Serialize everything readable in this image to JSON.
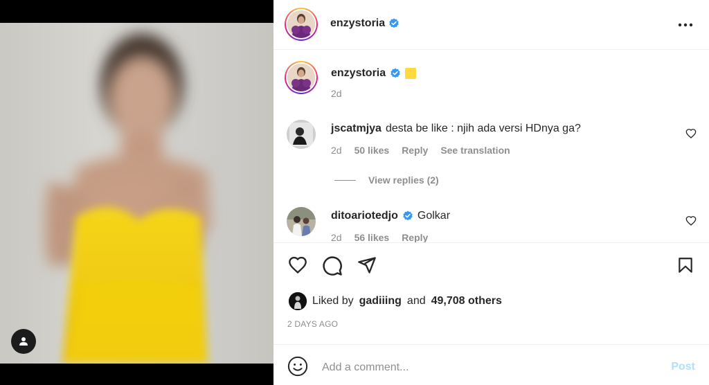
{
  "post": {
    "author": "enzystoria",
    "caption_emoji": "yellow-square",
    "caption_time": "2d"
  },
  "comments": [
    {
      "username": "jscatmjya",
      "text": "desta be like : njih ada versi HDnya ga?",
      "time": "2d",
      "likes": "50 likes",
      "reply_label": "Reply",
      "translate_label": "See translation",
      "view_replies": "View replies (2)"
    },
    {
      "username": "ditoariotedjo",
      "verified": true,
      "text": "Golkar",
      "time": "2d",
      "likes": "56 likes",
      "reply_label": "Reply"
    }
  ],
  "engagement": {
    "liked_prefix": "Liked by",
    "liked_user": "gadiiing",
    "liked_mid": "and",
    "liked_count": "49,708 others",
    "timestamp": "2 DAYS AGO"
  },
  "composer": {
    "placeholder": "Add a comment...",
    "post_label": "Post"
  },
  "colors": {
    "verified": "#3897f0",
    "post_button": "#b2dffc",
    "dress": "#f2d21a"
  },
  "icons": [
    "user-tag-icon",
    "more-options-icon",
    "verified-icon",
    "heart-icon",
    "comment-icon",
    "share-icon",
    "bookmark-icon",
    "emoji-icon"
  ]
}
